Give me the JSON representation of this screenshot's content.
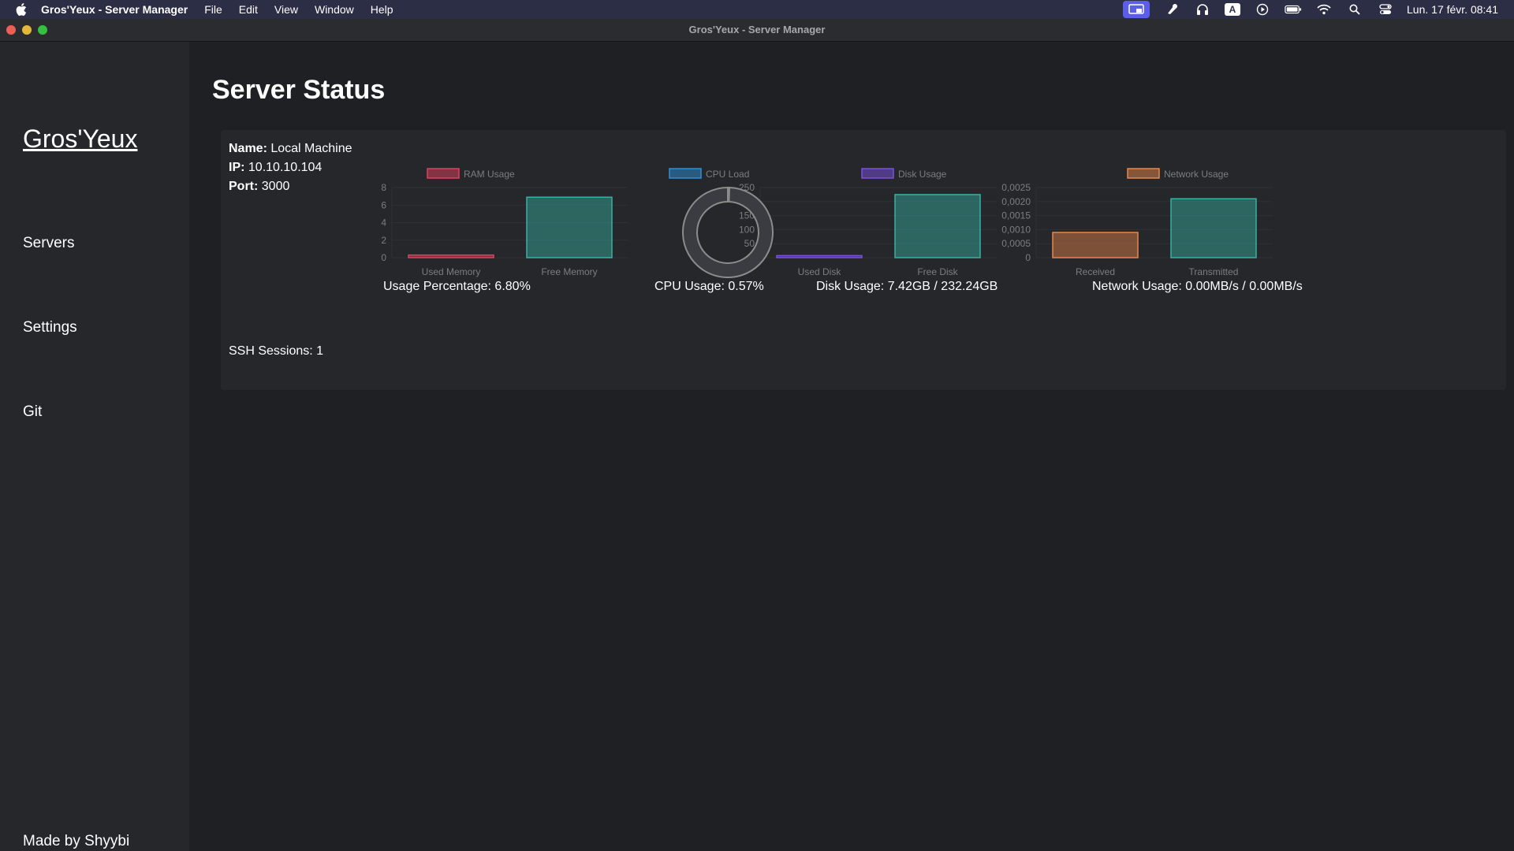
{
  "menubar": {
    "app_name": "Gros'Yeux - Server Manager",
    "menus": [
      "File",
      "Edit",
      "View",
      "Window",
      "Help"
    ],
    "status_icons": [
      "screen-mirroring-icon",
      "color-picker-icon",
      "headphones-icon",
      "input-source-icon",
      "play-icon",
      "battery-icon",
      "wifi-icon",
      "search-icon",
      "control-center-icon"
    ],
    "input_source_letter": "A",
    "clock": "Lun. 17 févr.  08:41"
  },
  "window": {
    "title": "Gros'Yeux - Server Manager"
  },
  "sidebar": {
    "brand": "Gros'Yeux",
    "items": [
      {
        "label": "Servers"
      },
      {
        "label": "Settings"
      },
      {
        "label": "Git"
      }
    ],
    "credit": "Made by Shyybi"
  },
  "main": {
    "title": "Server Status",
    "server": {
      "name_label": "Name:",
      "name": "Local Machine",
      "ip_label": "IP:",
      "ip": "10.10.10.104",
      "port_label": "Port:",
      "port": "3000",
      "ssh_sessions": "SSH Sessions: 1"
    },
    "captions": {
      "ram": "Usage Percentage: 6.80%",
      "cpu": "CPU Usage: 0.57%",
      "disk": "Disk Usage: 7.42GB / 232.24GB",
      "network": "Network Usage: 0.00MB/s / 0.00MB/s"
    }
  },
  "colors": {
    "ram": "#e0405e",
    "cpu": "#2d8fd6",
    "disk": "#7c4fe0",
    "network": "#e8864a",
    "free": "#38b2a4"
  },
  "chart_data": [
    {
      "type": "bar",
      "legend": "RAM Usage",
      "categories": [
        "Used Memory",
        "Free Memory"
      ],
      "values": [
        0.3,
        6.9
      ],
      "ylim": [
        0,
        8
      ],
      "yticks": [
        "0",
        "2",
        "4",
        "6",
        "8"
      ]
    },
    {
      "type": "pie",
      "legend": "CPU Load",
      "values": [
        0.57,
        99.43
      ]
    },
    {
      "type": "bar",
      "legend": "Disk Usage",
      "categories": [
        "Used Disk",
        "Free Disk"
      ],
      "values": [
        7.42,
        224.82
      ],
      "ylim": [
        0,
        250
      ],
      "yticks": [
        "0",
        "50",
        "100",
        "150",
        "200",
        "250"
      ]
    },
    {
      "type": "bar",
      "legend": "Network Usage",
      "categories": [
        "Received",
        "Transmitted"
      ],
      "values": [
        0.0009,
        0.0021
      ],
      "ylim": [
        0,
        0.0025
      ],
      "yticks": [
        "0",
        "0,0005",
        "0,0010",
        "0,0015",
        "0,0020",
        "0,0025"
      ]
    }
  ]
}
